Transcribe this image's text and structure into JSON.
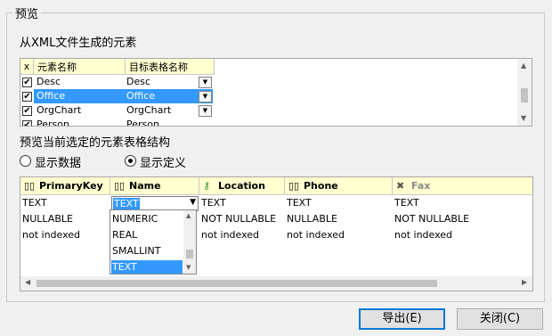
{
  "group": {
    "title": "预览"
  },
  "elements": {
    "heading": "从XML文件生成的元素",
    "headers": [
      "x",
      "元素名称",
      "目标表格名称"
    ],
    "rows": [
      {
        "name": "Desc",
        "target": "Desc",
        "checked": true
      },
      {
        "name": "Office",
        "target": "Office",
        "checked": true,
        "selected": true
      },
      {
        "name": "OrgChart",
        "target": "OrgChart",
        "checked": true
      },
      {
        "name": "Person",
        "target": "Person",
        "checked": true
      }
    ]
  },
  "preview": {
    "heading": "预览当前选定的元素表格结构",
    "radio_data": "显示数据",
    "radio_definition": "显示定义",
    "selected_mode": "definition"
  },
  "structure": {
    "columns": [
      {
        "name": "PrimaryKey",
        "icon": "key-column-icon"
      },
      {
        "name": "Name",
        "icon": "column-icon"
      },
      {
        "name": "Location",
        "icon": "foreign-key-column-icon"
      },
      {
        "name": "Phone",
        "icon": "column-icon"
      },
      {
        "name": "Fax",
        "icon": "excluded-column-icon",
        "disabled": true
      }
    ],
    "rows": [
      [
        "TEXT",
        "TEXT",
        "TEXT",
        "TEXT",
        "TEXT"
      ],
      [
        "NULLABLE",
        "",
        "NOT NULLABLE",
        "NULLABLE",
        "NOT NULLABLE"
      ],
      [
        "not indexed",
        "",
        "not indexed",
        "not indexed",
        "not indexed"
      ]
    ],
    "type_dropdown": {
      "value": "TEXT",
      "options": [
        "NUMERIC",
        "REAL",
        "SMALLINT",
        "TEXT"
      ],
      "selected": "TEXT"
    }
  },
  "buttons": {
    "export": "导出(E)",
    "close": "关闭(C)"
  },
  "colors": {
    "selection": "#3399ff",
    "header": "#ffffd0"
  }
}
